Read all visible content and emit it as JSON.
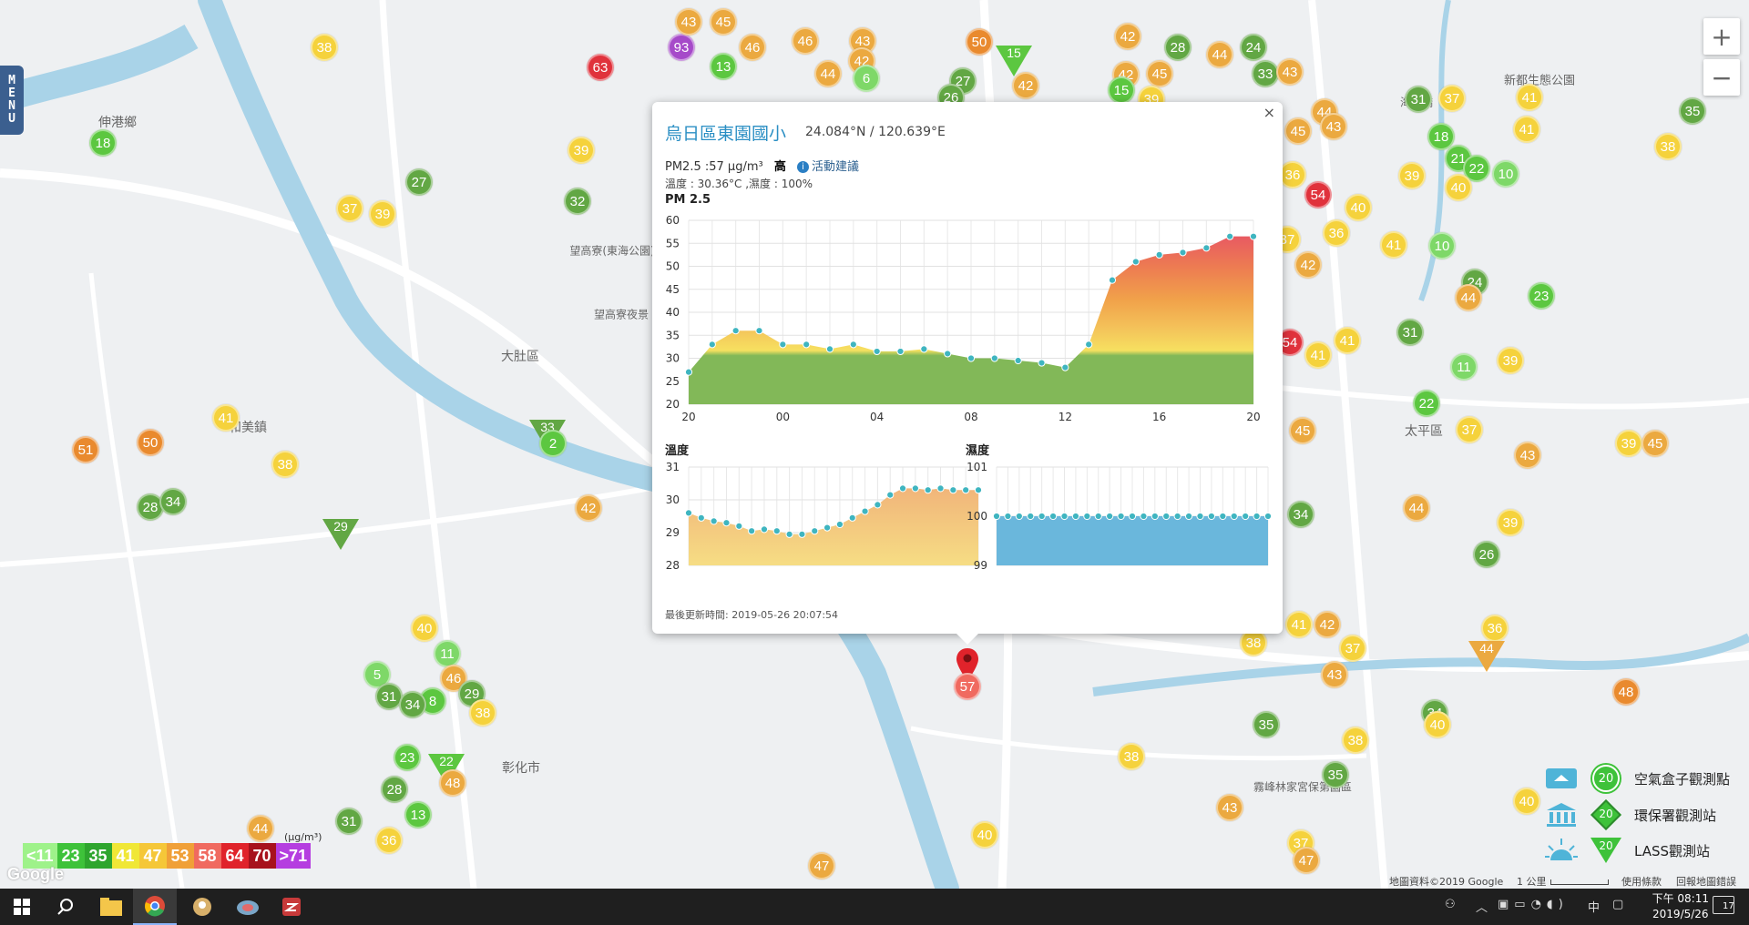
{
  "map": {
    "labels": [
      {
        "text": "大肚區"
      },
      {
        "text": "彰化市"
      },
      {
        "text": "太平區"
      },
      {
        "text": "和美鎮"
      },
      {
        "text": "伸港鄉"
      },
      {
        "text": "望高寮(東海公園)"
      },
      {
        "text": "望高寮夜景"
      },
      {
        "text": "海天橋"
      },
      {
        "text": "新都生態公園"
      },
      {
        "text": "霧峰林家宮保第園區"
      }
    ]
  },
  "markers": [
    {
      "value": "38",
      "color": "#f5d23c"
    },
    {
      "value": "18",
      "color": "#5cc740"
    },
    {
      "value": "93",
      "color": "#a64ac9"
    },
    {
      "value": "43",
      "color": "#eba940"
    },
    {
      "value": "45",
      "color": "#eba940"
    },
    {
      "value": "63",
      "color": "#e0323c"
    },
    {
      "value": "13",
      "color": "#5cc740"
    },
    {
      "value": "46",
      "color": "#eba940"
    },
    {
      "value": "46",
      "color": "#eba940"
    },
    {
      "value": "43",
      "color": "#eba940"
    },
    {
      "value": "44",
      "color": "#eba940"
    },
    {
      "value": "42",
      "color": "#eba940"
    },
    {
      "value": "6",
      "color": "#7ed868"
    },
    {
      "value": "50",
      "color": "#e98a2e"
    },
    {
      "value": "15",
      "color": "#5cc740",
      "shape": "tri"
    },
    {
      "value": "27",
      "color": "#62a744"
    },
    {
      "value": "26",
      "color": "#62a744"
    },
    {
      "value": "42",
      "color": "#eba940"
    },
    {
      "value": "42",
      "color": "#eba940"
    },
    {
      "value": "28",
      "color": "#62a744"
    },
    {
      "value": "44",
      "color": "#eba940"
    },
    {
      "value": "24",
      "color": "#62a744"
    },
    {
      "value": "33",
      "color": "#62a744"
    },
    {
      "value": "43",
      "color": "#eba940"
    },
    {
      "value": "42",
      "color": "#eba940"
    },
    {
      "value": "45",
      "color": "#eba940"
    },
    {
      "value": "15",
      "color": "#5cc740"
    },
    {
      "value": "39",
      "color": "#f5d23c"
    },
    {
      "value": "39",
      "color": "#f5d23c"
    },
    {
      "value": "27",
      "color": "#62a744"
    },
    {
      "value": "32",
      "color": "#62a744"
    },
    {
      "value": "37",
      "color": "#f5d23c"
    },
    {
      "value": "39",
      "color": "#f5d23c"
    },
    {
      "value": "31",
      "color": "#62a744"
    },
    {
      "value": "37",
      "color": "#f5d23c"
    },
    {
      "value": "41",
      "color": "#f5d23c"
    },
    {
      "value": "35",
      "color": "#62a744"
    },
    {
      "value": "38",
      "color": "#f5d23c"
    },
    {
      "value": "44",
      "color": "#eba940"
    },
    {
      "value": "43",
      "color": "#eba940"
    },
    {
      "value": "45",
      "color": "#eba940"
    },
    {
      "value": "18",
      "color": "#5cc740"
    },
    {
      "value": "21",
      "color": "#5cc740"
    },
    {
      "value": "22",
      "color": "#5cc740"
    },
    {
      "value": "10",
      "color": "#7ed868"
    },
    {
      "value": "41",
      "color": "#f5d23c"
    },
    {
      "value": "36",
      "color": "#f5d23c"
    },
    {
      "value": "54",
      "color": "#e0323c"
    },
    {
      "value": "40",
      "color": "#f5d23c"
    },
    {
      "value": "39",
      "color": "#f5d23c"
    },
    {
      "value": "40",
      "color": "#f5d23c"
    },
    {
      "value": "37",
      "color": "#f5d23c"
    },
    {
      "value": "36",
      "color": "#f5d23c"
    },
    {
      "value": "41",
      "color": "#f5d23c"
    },
    {
      "value": "10",
      "color": "#7ed868"
    },
    {
      "value": "42",
      "color": "#eba940"
    },
    {
      "value": "24",
      "color": "#62a744"
    },
    {
      "value": "44",
      "color": "#eba940"
    },
    {
      "value": "23",
      "color": "#5cc740"
    },
    {
      "value": "54",
      "color": "#e0323c"
    },
    {
      "value": "41",
      "color": "#f5d23c"
    },
    {
      "value": "41",
      "color": "#f5d23c"
    },
    {
      "value": "31",
      "color": "#62a744"
    },
    {
      "value": "11",
      "color": "#7ed868"
    },
    {
      "value": "39",
      "color": "#f5d23c"
    },
    {
      "value": "22",
      "color": "#5cc740"
    },
    {
      "value": "37",
      "color": "#f5d23c"
    },
    {
      "value": "43",
      "color": "#eba940"
    },
    {
      "value": "45",
      "color": "#eba940"
    },
    {
      "value": "39",
      "color": "#f5d23c"
    },
    {
      "value": "34",
      "color": "#62a744"
    },
    {
      "value": "44",
      "color": "#eba940"
    },
    {
      "value": "39",
      "color": "#f5d23c"
    },
    {
      "value": "26",
      "color": "#62a744"
    },
    {
      "value": "33",
      "color": "#62a744",
      "shape": "tri"
    },
    {
      "value": "2",
      "color": "#5cc740"
    },
    {
      "value": "42",
      "color": "#eba940"
    },
    {
      "value": "41",
      "color": "#f5d23c"
    },
    {
      "value": "51",
      "color": "#e98a2e"
    },
    {
      "value": "50",
      "color": "#e98a2e"
    },
    {
      "value": "38",
      "color": "#f5d23c"
    },
    {
      "value": "28",
      "color": "#62a744"
    },
    {
      "value": "34",
      "color": "#62a744"
    },
    {
      "value": "29",
      "color": "#62a744",
      "shape": "tri"
    },
    {
      "value": "40",
      "color": "#f5d23c"
    },
    {
      "value": "11",
      "color": "#7ed868"
    },
    {
      "value": "5",
      "color": "#7ed868"
    },
    {
      "value": "31",
      "color": "#62a744"
    },
    {
      "value": "46",
      "color": "#eba940"
    },
    {
      "value": "8",
      "color": "#5cc740"
    },
    {
      "value": "29",
      "color": "#62a744"
    },
    {
      "value": "34",
      "color": "#62a744"
    },
    {
      "value": "38",
      "color": "#f5d23c"
    },
    {
      "value": "23",
      "color": "#5cc740"
    },
    {
      "value": "22",
      "color": "#5cc740",
      "shape": "tri"
    },
    {
      "value": "48",
      "color": "#eba940"
    },
    {
      "value": "28",
      "color": "#62a744"
    },
    {
      "value": "13",
      "color": "#5cc740"
    },
    {
      "value": "31",
      "color": "#62a744"
    },
    {
      "value": "44",
      "color": "#eba940"
    },
    {
      "value": "36",
      "color": "#f5d23c"
    },
    {
      "value": "40",
      "color": "#f5d23c"
    },
    {
      "value": "38",
      "color": "#f5d23c"
    },
    {
      "value": "41",
      "color": "#f5d23c"
    },
    {
      "value": "42",
      "color": "#eba940"
    },
    {
      "value": "38",
      "color": "#f5d23c"
    },
    {
      "value": "37",
      "color": "#f5d23c"
    },
    {
      "value": "43",
      "color": "#eba940"
    },
    {
      "value": "36",
      "color": "#f5d23c"
    },
    {
      "value": "44",
      "color": "#eba940",
      "shape": "tri"
    },
    {
      "value": "34",
      "color": "#62a744"
    },
    {
      "value": "38",
      "color": "#f5d23c"
    },
    {
      "value": "35",
      "color": "#62a744"
    },
    {
      "value": "43",
      "color": "#eba940"
    },
    {
      "value": "37",
      "color": "#f5d23c"
    },
    {
      "value": "47",
      "color": "#eba940"
    },
    {
      "value": "47",
      "color": "#eba940"
    },
    {
      "value": "48",
      "color": "#e98a2e"
    },
    {
      "value": "40",
      "color": "#f5d23c"
    },
    {
      "value": "40",
      "color": "#f5d23c"
    },
    {
      "value": "35",
      "color": "#62a744"
    },
    {
      "value": "45",
      "color": "#eba940"
    },
    {
      "value": "38",
      "color": "#f5d23c"
    },
    {
      "value": "57",
      "color": "#e0323c"
    }
  ],
  "zoom": {
    "plus": "+",
    "minus": "−"
  },
  "menu": {
    "letters": [
      "M",
      "E",
      "N",
      "U"
    ]
  },
  "legend": {
    "cells": [
      {
        "text": "<11",
        "color": "#9ef28a"
      },
      {
        "text": "23",
        "color": "#3ec23a"
      },
      {
        "text": "35",
        "color": "#2ea52e"
      },
      {
        "text": "41",
        "color": "#f0e736"
      },
      {
        "text": "47",
        "color": "#f5c738"
      },
      {
        "text": "53",
        "color": "#f0a038"
      },
      {
        "text": "58",
        "color": "#f06a60"
      },
      {
        "text": "64",
        "color": "#e0232b"
      },
      {
        "text": "70",
        "color": "#a7121d"
      },
      {
        "text": ">71",
        "color": "#b53ee0"
      }
    ],
    "unit": "(μg/m³)"
  },
  "google_logo": "Google",
  "station_legend": [
    {
      "label": "空氣盒子觀測點",
      "icon": "airbox-icon",
      "value": "20"
    },
    {
      "label": "環保署觀測站",
      "icon": "government-building-icon",
      "value": "20"
    },
    {
      "label": "LASS觀測站",
      "icon": "sun-icon",
      "value": "20"
    }
  ],
  "attribution": "地圖資料©2019 Google",
  "scale": "1 公里",
  "terms": "使用條款",
  "report": "回報地圖錯誤",
  "popup": {
    "close": "×",
    "station_name": "烏日區東園國小",
    "coords": "24.084°N / 120.639°E",
    "pm_text": "PM2.5 :57 μg/m³",
    "level": "高",
    "advice": "活動建議",
    "env_text": "溫度 : 30.36°C ,濕度 : 100%",
    "pm_title": "PM 2.5",
    "temp_title": "溫度",
    "hum_title": "濕度",
    "updated": "最後更新時間: 2019-05-26 20:07:54",
    "pin_value": "57"
  },
  "chart_data": [
    {
      "type": "area",
      "title": "PM 2.5",
      "x_ticks": [
        "20",
        "00",
        "04",
        "08",
        "12",
        "16",
        "20"
      ],
      "ylim": [
        20,
        60
      ],
      "y_ticks": [
        20,
        25,
        30,
        35,
        40,
        45,
        50,
        55,
        60
      ],
      "grid": true,
      "values": [
        27,
        33,
        36,
        36,
        33,
        33,
        32,
        33,
        31.5,
        31.5,
        32,
        31,
        30,
        30,
        29.5,
        29,
        28,
        33,
        47,
        51,
        52.5,
        53,
        54,
        56.5,
        56.5
      ]
    },
    {
      "type": "area",
      "title": "溫度",
      "ylim": [
        28,
        31
      ],
      "y_ticks": [
        28,
        29,
        30,
        31
      ],
      "grid": true,
      "values": [
        29.6,
        29.45,
        29.35,
        29.3,
        29.2,
        29.05,
        29.1,
        29.05,
        28.95,
        28.95,
        29.05,
        29.15,
        29.25,
        29.45,
        29.65,
        29.85,
        30.15,
        30.35,
        30.35,
        30.3,
        30.35,
        30.3,
        30.3,
        30.3
      ]
    },
    {
      "type": "area",
      "title": "濕度",
      "ylim": [
        99,
        101
      ],
      "y_ticks": [
        99,
        100,
        101
      ],
      "grid": true,
      "values": [
        100,
        100,
        100,
        100,
        100,
        100,
        100,
        100,
        100,
        100,
        100,
        100,
        100,
        100,
        100,
        100,
        100,
        100,
        100,
        100,
        100,
        100,
        100,
        100,
        100
      ]
    }
  ],
  "taskbar": {
    "clock_time": "下午 08:11",
    "clock_date": "2019/5/26",
    "ime": "中",
    "notify_count": "17"
  }
}
